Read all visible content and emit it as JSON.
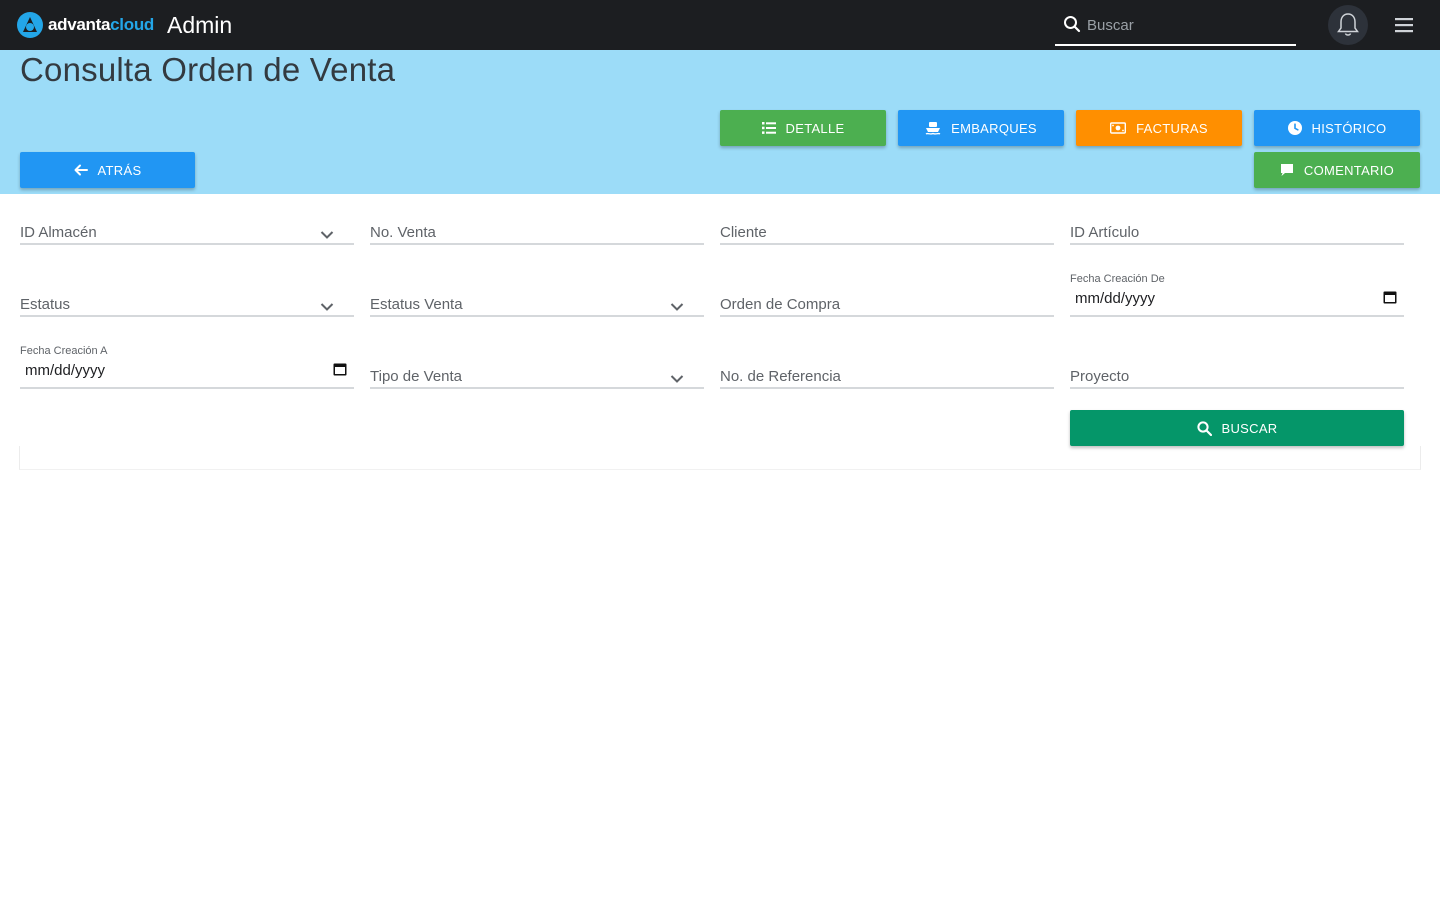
{
  "brand": {
    "logo_part1": "advanta",
    "logo_part2": "cloud",
    "app_title": "Admin",
    "accent": "#23a6e8"
  },
  "header": {
    "search_placeholder": "Buscar",
    "bell_icon": "bell-icon",
    "menu_icon": "hamburger-icon"
  },
  "page": {
    "title": "Consulta Orden de Venta",
    "hero_color": "#9cdcf8"
  },
  "actions": {
    "detalle": "DETALLE",
    "embarques": "EMBARQUES",
    "facturas": "FACTURAS",
    "historico": "HISTÓRICO",
    "comentario": "COMENTARIO",
    "atras": "ATRÁS"
  },
  "form": {
    "id_almacen": "ID Almacén",
    "no_venta": "No. Venta",
    "cliente": "Cliente",
    "id_articulo": "ID Artículo",
    "estatus": "Estatus",
    "estatus_venta": "Estatus Venta",
    "orden_compra": "Orden de Compra",
    "fecha_de_label": "Fecha Creación De",
    "fecha_de_value": "mm/dd/yyyy",
    "fecha_a_label": "Fecha Creación A",
    "fecha_a_value": "mm/dd/yyyy",
    "tipo_venta": "Tipo de Venta",
    "no_referencia": "No. de Referencia",
    "proyecto": "Proyecto",
    "buscar": "BUSCAR"
  },
  "colors": {
    "green": "#4caf50",
    "blue": "#2196f3",
    "orange": "#ff8f00",
    "search_green": "#059669"
  }
}
